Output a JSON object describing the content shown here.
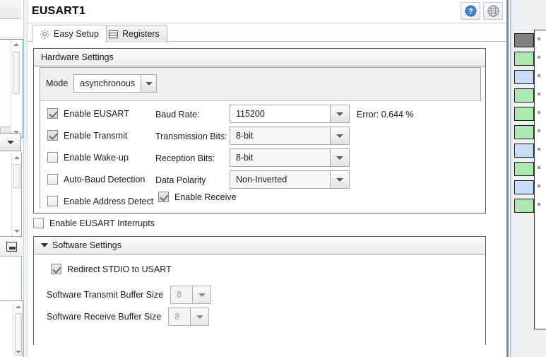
{
  "window": {
    "title": "EUSART1",
    "help_icon": "help-question-icon",
    "globe_icon": "globe-icon"
  },
  "tabs": [
    {
      "label": "Easy Setup",
      "icon": "gear-icon",
      "active": true
    },
    {
      "label": "Registers",
      "icon": "table-rows-icon",
      "active": false
    }
  ],
  "hardware_settings": {
    "header": "Hardware Settings",
    "mode": {
      "label": "Mode",
      "value": "asynchronous",
      "arrow_icon": "chevron-down-icon"
    },
    "checkboxes": [
      {
        "label": "Enable EUSART",
        "checked": true
      },
      {
        "label": "Enable Transmit",
        "checked": true
      },
      {
        "label": "Enable Wake-up",
        "checked": false
      },
      {
        "label": "Auto-Baud Detection",
        "checked": false
      },
      {
        "label": "Enable Address Detect",
        "checked": false
      }
    ],
    "fields": [
      {
        "label": "Baud Rate:",
        "value": "115200",
        "editable": true
      },
      {
        "label": "Transmission Bits:",
        "value": "8-bit",
        "editable": false
      },
      {
        "label": "Reception Bits:",
        "value": "8-bit",
        "editable": false
      },
      {
        "label": "Data Polarity",
        "value": "Non-Inverted",
        "editable": false
      }
    ],
    "error_text": "Error: 0.644 %",
    "enable_receive": {
      "label": "Enable Receive",
      "checked": true
    }
  },
  "interrupts": {
    "label": "Enable EUSART Interrupts",
    "checked": false
  },
  "software_settings": {
    "header": "Software Settings",
    "expanded": true,
    "collapse_icon": "triangle-down-icon",
    "redirect_stdio": {
      "label": "Redirect STDIO to USART",
      "checked": true
    },
    "transmit_buffer": {
      "label": "Software Transmit Buffer Size",
      "value": "8"
    },
    "receive_buffer": {
      "label": "Software Receive Buffer Size",
      "value": "8"
    }
  },
  "pin_panel": {
    "pins": [
      {
        "color": "#808080"
      },
      {
        "color": "#ade8b0"
      },
      {
        "color": "#c5ddf7"
      },
      {
        "color": "#ade8b0"
      },
      {
        "color": "#ade8b0"
      },
      {
        "color": "#ade8b0"
      },
      {
        "color": "#c5ddf7"
      },
      {
        "color": "#ade8b0"
      },
      {
        "color": "#c5ddf7"
      },
      {
        "color": "#ade8b0"
      }
    ]
  },
  "colors": {
    "accent": "#3a93c7",
    "help_blue": "#2f79bd",
    "panel_bg": "#f0f0f0",
    "border": "#5a5a5a"
  }
}
